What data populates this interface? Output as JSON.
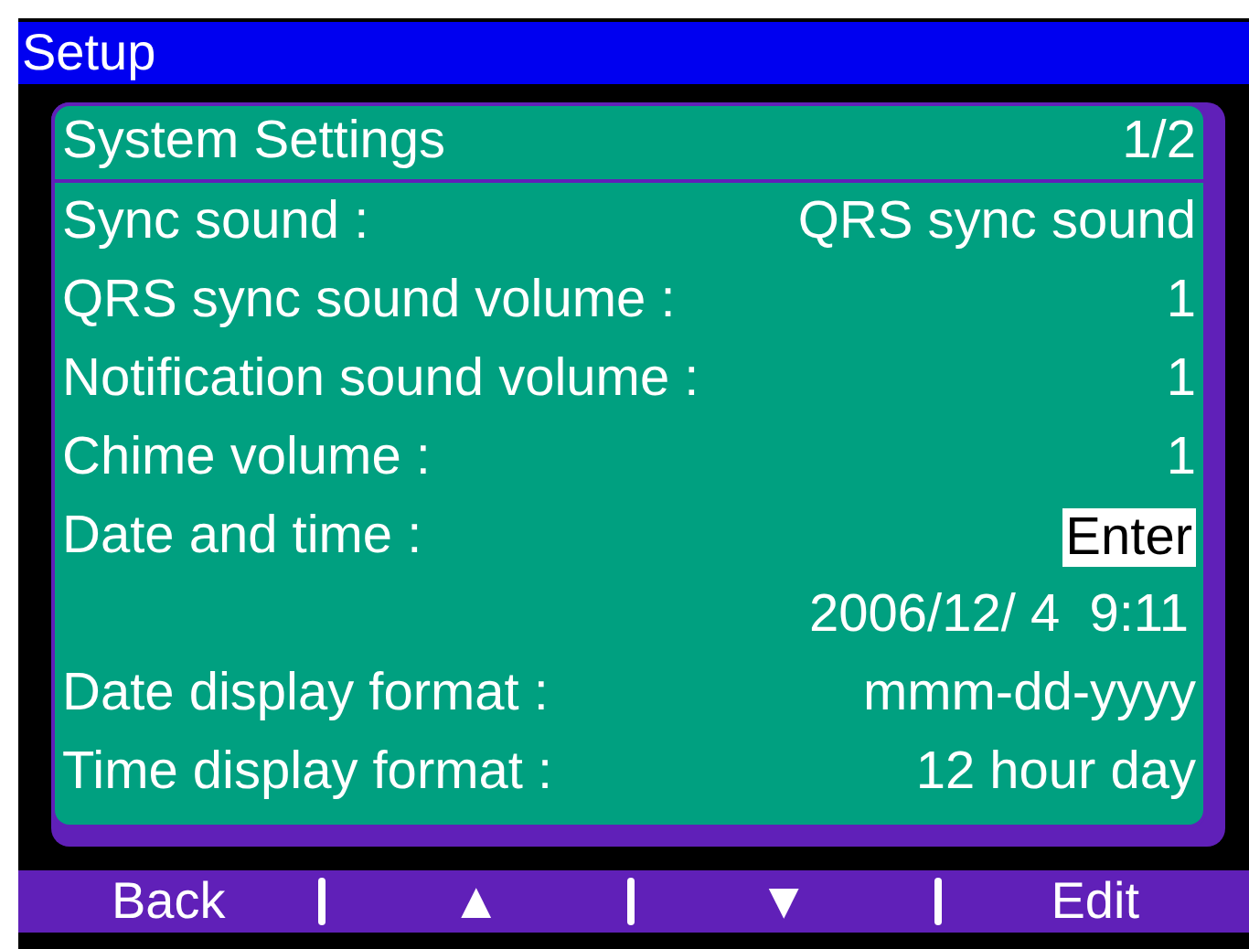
{
  "window": {
    "title": "Setup"
  },
  "panel": {
    "title": "System Settings",
    "page": "1/2",
    "rows": [
      {
        "kind": "setting",
        "label": "Sync sound :",
        "value": "QRS sync sound"
      },
      {
        "kind": "setting",
        "label": "QRS sync sound volume :",
        "value": "1"
      },
      {
        "kind": "setting",
        "label": "Notification sound volume :",
        "value": "1"
      },
      {
        "kind": "setting",
        "label": "Chime volume :",
        "value": "1"
      },
      {
        "kind": "button",
        "label": "Date and time :",
        "value": "Enter",
        "selected": true
      },
      {
        "kind": "readout",
        "value": "2006/12/ 4  9:11"
      },
      {
        "kind": "setting",
        "label": "Date display format :",
        "value": "mmm-dd-yyyy"
      },
      {
        "kind": "setting",
        "label": "Time display format :",
        "value": "12 hour day"
      }
    ]
  },
  "softkeys": [
    {
      "label": "Back"
    },
    {
      "label": "▲"
    },
    {
      "label": "▼"
    },
    {
      "label": "Edit"
    }
  ]
}
